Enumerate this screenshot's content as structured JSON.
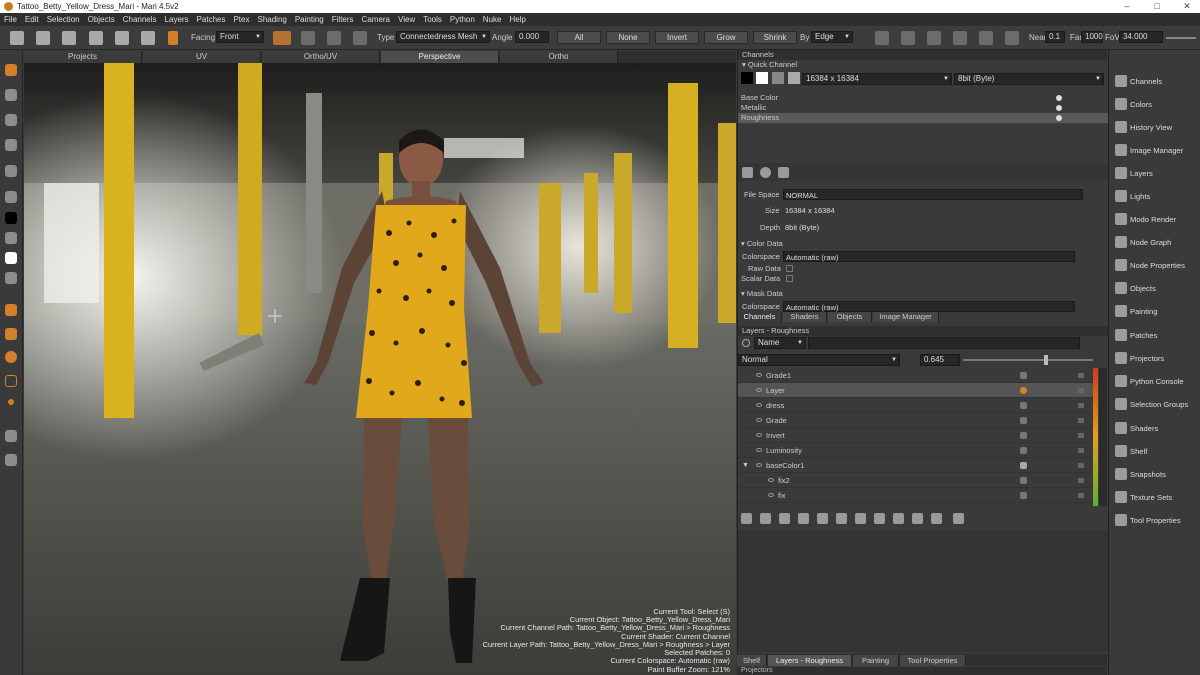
{
  "window": {
    "title": "Tattoo_Betty_Yellow_Dress_Mari - Mari 4.5v2",
    "controls": [
      "–",
      "□",
      "✕"
    ]
  },
  "menu": [
    "File",
    "Edit",
    "Selection",
    "Objects",
    "Channels",
    "Layers",
    "Patches",
    "Ptex",
    "Shading",
    "Painting",
    "Filters",
    "Camera",
    "View",
    "Tools",
    "Python",
    "Nuke",
    "Help"
  ],
  "toolbar": {
    "facing_label": "Facing",
    "facing_value": "Front",
    "type_label": "Type",
    "type_value": "Connectedness Mesh",
    "angle_label": "Angle",
    "angle_value": "0.000",
    "btn_all": "All",
    "btn_none": "None",
    "btn_invert": "Invert",
    "btn_grow": "Grow",
    "btn_shrink": "Shrink",
    "by_label": "By",
    "by_value": "Edge",
    "near_label": "Near",
    "near_value": "0.1",
    "far_label": "Far",
    "far_value": "1000",
    "fov_label": "FoV",
    "fov_value": "34.000"
  },
  "view_tabs": [
    "Projects",
    "UV",
    "Ortho/UV",
    "Perspective",
    "Ortho"
  ],
  "active_view_tab": "Perspective",
  "status_lines": [
    "Current Tool: Select (S)",
    "Current Object: Tattoo_Betty_Yellow_Dress_Mari",
    "Current Channel Path: Tattoo_Betty_Yellow_Dress_Mari > Roughness",
    "Current Shader: Current Channel",
    "Current Layer Path: Tattoo_Betty_Yellow_Dress_Mari > Roughness > Layer",
    "Selected Patches: 0",
    "Current Colorspace: Automatic (raw)",
    "Paint Buffer Zoom: 121%"
  ],
  "channels_panel": {
    "title": "Channels",
    "quick_channel": "Quick Channel",
    "size": "16384 x 16384",
    "depth": "8bit  (Byte)",
    "items": [
      {
        "name": "Base Color"
      },
      {
        "name": "Metallic"
      },
      {
        "name": "Roughness",
        "selected": true
      }
    ]
  },
  "properties": {
    "file_space_label": "File Space",
    "file_space": "NORMAL",
    "size_label": "Size",
    "size": "16384 x 16384",
    "depth_label": "Depth",
    "depth": "8bit  (Byte)",
    "color_data": "Color Data",
    "colorspace_label": "Colorspace",
    "colorspace": "Automatic (raw)",
    "raw_data": "Raw Data",
    "scalar_data": "Scalar Data",
    "mask_data": "Mask Data",
    "mask_colorspace": "Automatic (raw)"
  },
  "mid_tabs": [
    "Channels",
    "Shaders",
    "Objects",
    "Image Manager"
  ],
  "layers_panel": {
    "title": "Layers - Roughness",
    "filter_label": "Name",
    "blend_mode": "Normal",
    "opacity": "0.645",
    "opacity_fraction": 0.645,
    "items": [
      {
        "name": "Grade1",
        "indent": 0,
        "icon": "pencil"
      },
      {
        "name": "Layer",
        "indent": 0,
        "icon": "orange-dot",
        "selected": true
      },
      {
        "name": "dress",
        "indent": 0,
        "icon": "paint"
      },
      {
        "name": "Grade",
        "indent": 0,
        "icon": "pencil"
      },
      {
        "name": "Invert",
        "indent": 0,
        "icon": "pencil"
      },
      {
        "name": "Luminosity",
        "indent": 0,
        "icon": "pencil"
      },
      {
        "name": "baseColor1",
        "indent": 0,
        "icon": "folder",
        "group": true
      },
      {
        "name": "fix2",
        "indent": 1,
        "icon": "paint"
      },
      {
        "name": "fix",
        "indent": 1,
        "icon": "paint"
      }
    ]
  },
  "bottom_tabs": [
    "Shelf",
    "Layers - Roughness",
    "Painting",
    "Tool Properties"
  ],
  "bottom_panel_next": "Projectors",
  "side_dock": [
    "Channels",
    "Colors",
    "History View",
    "Image Manager",
    "Layers",
    "Lights",
    "Modo Render",
    "Node Graph",
    "Node Properties",
    "Objects",
    "Painting",
    "Patches",
    "Projectors",
    "Python Console",
    "Selection Groups",
    "Shaders",
    "Shelf",
    "Snapshots",
    "Texture Sets",
    "Tool Properties"
  ],
  "colors": {
    "accent": "#d2802c",
    "dress": "#e0a81a",
    "pillar": "#d8b21f"
  }
}
